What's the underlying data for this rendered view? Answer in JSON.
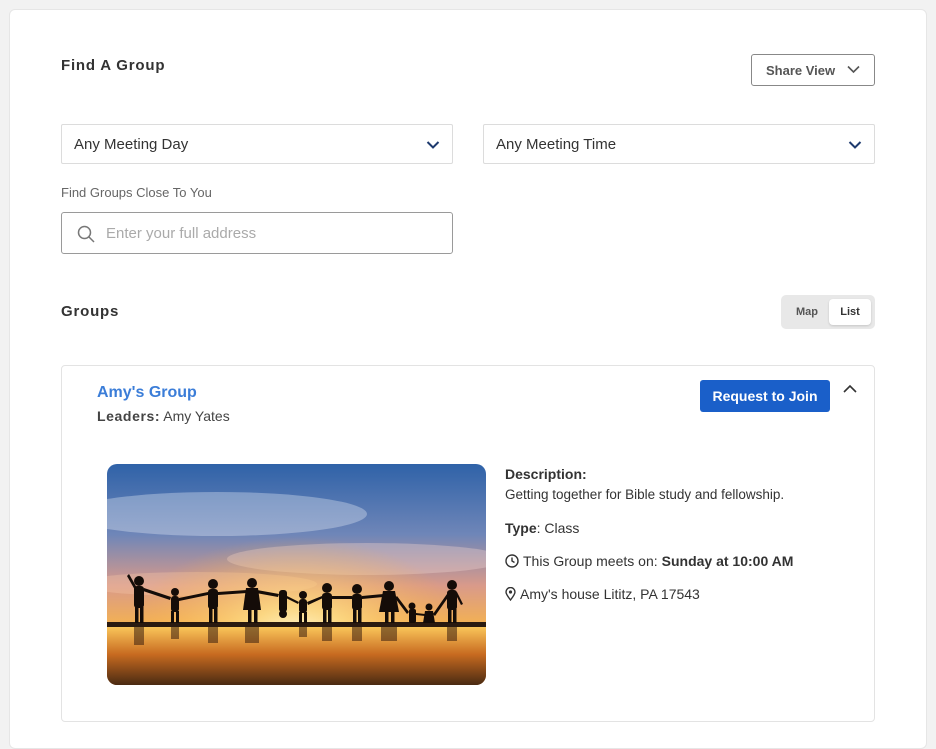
{
  "header": {
    "title": "Find A Group",
    "share_label": "Share View"
  },
  "filters": {
    "meeting_day": "Any Meeting Day",
    "meeting_time": "Any Meeting Time",
    "near_label": "Find Groups Close To You",
    "address_placeholder": "Enter your full address"
  },
  "groups_section": {
    "title": "Groups",
    "view_options": [
      "Map",
      "List"
    ],
    "selected_view": "List"
  },
  "group": {
    "name": "Amy's Group",
    "leaders_label": "Leaders:",
    "leaders": "Amy Yates",
    "join_label": "Request to Join",
    "description_label": "Description:",
    "description": "Getting together for Bible study and fellowship.",
    "type_label": "Type",
    "type": "Class",
    "meets_label": "This Group meets on:",
    "meets": "Sunday at 10:00 AM",
    "location": "Amy's house Lititz, PA 17543"
  },
  "colors": {
    "accent": "#1a5fc9",
    "link": "#3b7dd8"
  },
  "icons": {
    "share": "chevron-down-icon",
    "select": "chevron-down-icon",
    "search": "search-icon",
    "collapse": "chevron-up-icon",
    "time": "clock-icon",
    "location": "map-pin-icon"
  }
}
